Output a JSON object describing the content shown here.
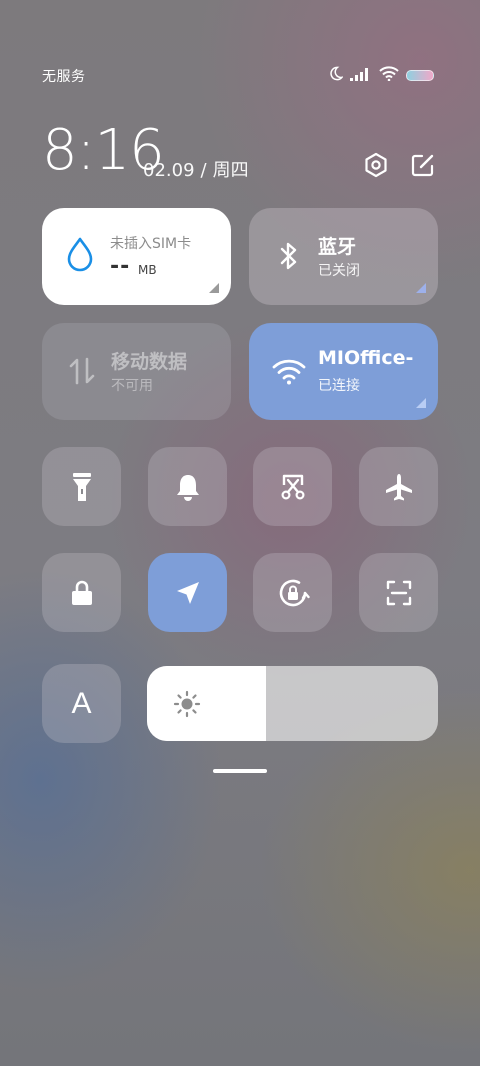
{
  "status_bar": {
    "carrier": "无服务",
    "icons": [
      "moon-icon",
      "signal-icon",
      "wifi-icon",
      "battery-icon"
    ]
  },
  "header": {
    "time": "8:16",
    "date": "02.09",
    "separator": "/",
    "weekday": "周四",
    "buttons": [
      "settings-icon",
      "edit-icon"
    ]
  },
  "tiles": {
    "sim": {
      "label": "未插入SIM卡",
      "usage_value": "--",
      "usage_unit": "MB",
      "icon": "water-drop-icon",
      "color": "#1a8fe6"
    },
    "bluetooth": {
      "title": "蓝牙",
      "status": "已关闭",
      "icon": "bluetooth-icon"
    },
    "mobile_data": {
      "title": "移动数据",
      "status": "不可用",
      "icon": "data-arrows-icon"
    },
    "wifi": {
      "title": "MIOffice-",
      "status": "已连接",
      "icon": "wifi-icon",
      "color": "#7e9ed8"
    }
  },
  "toggles_row1": [
    "flashlight-icon",
    "bell-icon",
    "screenshot-icon",
    "airplane-icon"
  ],
  "toggles_row2": [
    "lock-icon",
    "location-icon",
    "rotation-lock-icon",
    "scan-icon"
  ],
  "font_button": {
    "label": "A"
  },
  "brightness": {
    "level": 0.41,
    "icon": "sun-icon"
  }
}
